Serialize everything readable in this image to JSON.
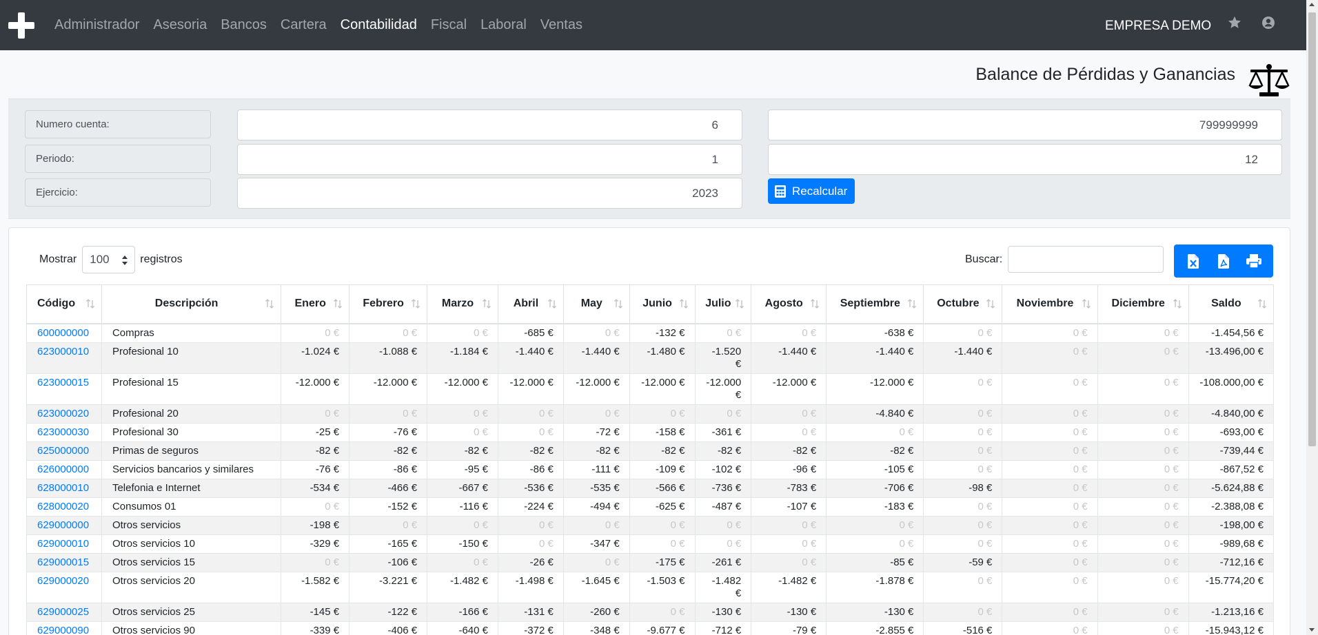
{
  "nav": {
    "items": [
      "Administrador",
      "Asesoria",
      "Bancos",
      "Cartera",
      "Contabilidad",
      "Fiscal",
      "Laboral",
      "Ventas"
    ],
    "active": "Contabilidad",
    "company": "EMPRESA DEMO"
  },
  "page": {
    "title": "Balance de Pérdidas y Ganancias"
  },
  "filters": {
    "cuenta": {
      "label": "Numero cuenta:",
      "from": "6",
      "to": "799999999"
    },
    "periodo": {
      "label": "Periodo:",
      "from": "1",
      "to": "12"
    },
    "ejercicio": {
      "label": "Ejercicio:",
      "value": "2023"
    },
    "recalc_label": "Recalcular"
  },
  "table_controls": {
    "show_label": "Mostrar",
    "page_length": "100",
    "records_label": "registros",
    "search_label": "Buscar:",
    "search_value": ""
  },
  "columns": [
    "Código",
    "Descripción",
    "Enero",
    "Febrero",
    "Marzo",
    "Abril",
    "May",
    "Junio",
    "Julio",
    "Agosto",
    "Septiembre",
    "Octubre",
    "Noviembre",
    "Diciembre",
    "Saldo"
  ],
  "rows": [
    [
      "600000000",
      "Compras",
      "0 €",
      "0 €",
      "0 €",
      "-685 €",
      "0 €",
      "-132 €",
      "0 €",
      "0 €",
      "-638 €",
      "0 €",
      "0 €",
      "0 €",
      "-1.454,56 €"
    ],
    [
      "623000010",
      "Profesional 10",
      "-1.024 €",
      "-1.088 €",
      "-1.184 €",
      "-1.440 €",
      "-1.440 €",
      "-1.480 €",
      "-1.520 €",
      "-1.440 €",
      "-1.440 €",
      "-1.440 €",
      "0 €",
      "0 €",
      "-13.496,00 €"
    ],
    [
      "623000015",
      "Profesional 15",
      "-12.000 €",
      "-12.000 €",
      "-12.000 €",
      "-12.000 €",
      "-12.000 €",
      "-12.000 €",
      "-12.000 €",
      "-12.000 €",
      "-12.000 €",
      "0 €",
      "0 €",
      "0 €",
      "-108.000,00 €"
    ],
    [
      "623000020",
      "Profesional 20",
      "0 €",
      "0 €",
      "0 €",
      "0 €",
      "0 €",
      "0 €",
      "0 €",
      "0 €",
      "-4.840 €",
      "0 €",
      "0 €",
      "0 €",
      "-4.840,00 €"
    ],
    [
      "623000030",
      "Profesional 30",
      "-25 €",
      "-76 €",
      "0 €",
      "0 €",
      "-72 €",
      "-158 €",
      "-361 €",
      "0 €",
      "0 €",
      "0 €",
      "0 €",
      "0 €",
      "-693,00 €"
    ],
    [
      "625000000",
      "Primas de seguros",
      "-82 €",
      "-82 €",
      "-82 €",
      "-82 €",
      "-82 €",
      "-82 €",
      "-82 €",
      "-82 €",
      "-82 €",
      "0 €",
      "0 €",
      "0 €",
      "-739,44 €"
    ],
    [
      "626000000",
      "Servicios bancarios y similares",
      "-76 €",
      "-86 €",
      "-95 €",
      "-86 €",
      "-111 €",
      "-109 €",
      "-102 €",
      "-96 €",
      "-105 €",
      "0 €",
      "0 €",
      "0 €",
      "-867,52 €"
    ],
    [
      "628000010",
      "Telefonia e Internet",
      "-534 €",
      "-466 €",
      "-667 €",
      "-536 €",
      "-535 €",
      "-566 €",
      "-736 €",
      "-783 €",
      "-706 €",
      "-98 €",
      "0 €",
      "0 €",
      "-5.624,88 €"
    ],
    [
      "628000020",
      "Consumos 01",
      "0 €",
      "-152 €",
      "-116 €",
      "-224 €",
      "-494 €",
      "-625 €",
      "-487 €",
      "-107 €",
      "-183 €",
      "0 €",
      "0 €",
      "0 €",
      "-2.388,08 €"
    ],
    [
      "629000000",
      "Otros servicios",
      "-198 €",
      "0 €",
      "0 €",
      "0 €",
      "0 €",
      "0 €",
      "0 €",
      "0 €",
      "0 €",
      "0 €",
      "0 €",
      "0 €",
      "-198,00 €"
    ],
    [
      "629000010",
      "Otros servicios 10",
      "-329 €",
      "-165 €",
      "-150 €",
      "0 €",
      "-347 €",
      "0 €",
      "0 €",
      "0 €",
      "0 €",
      "0 €",
      "0 €",
      "0 €",
      "-989,68 €"
    ],
    [
      "629000015",
      "Otros servicios 15",
      "0 €",
      "-106 €",
      "0 €",
      "-26 €",
      "0 €",
      "-175 €",
      "-261 €",
      "0 €",
      "-85 €",
      "-59 €",
      "0 €",
      "0 €",
      "-712,16 €"
    ],
    [
      "629000020",
      "Otros servicios 20",
      "-1.582 €",
      "-3.221 €",
      "-1.482 €",
      "-1.498 €",
      "-1.645 €",
      "-1.503 €",
      "-1.482 €",
      "-1.482 €",
      "-1.878 €",
      "0 €",
      "0 €",
      "0 €",
      "-15.774,20 €"
    ],
    [
      "629000025",
      "Otros servicios 25",
      "-145 €",
      "-122 €",
      "-166 €",
      "-131 €",
      "-260 €",
      "0 €",
      "-130 €",
      "-130 €",
      "-130 €",
      "0 €",
      "0 €",
      "0 €",
      "-1.213,16 €"
    ],
    [
      "629000090",
      "Otros servicios 90",
      "-339 €",
      "-406 €",
      "-640 €",
      "-372 €",
      "-348 €",
      "-9.677 €",
      "-712 €",
      "-79 €",
      "-2.855 €",
      "-516 €",
      "0 €",
      "0 €",
      "-15.943,12 €"
    ]
  ]
}
